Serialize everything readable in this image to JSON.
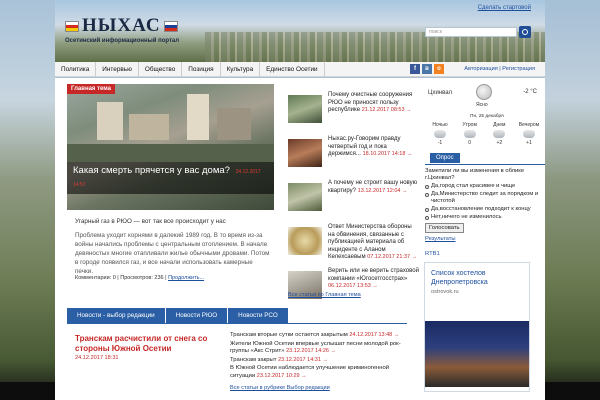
{
  "site": {
    "logo_text": "НЫХАС",
    "tagline": "Осетинский информационный портал",
    "make_start_page": "Сделать стартовой"
  },
  "search": {
    "placeholder": "поиск"
  },
  "nav": {
    "items": [
      "Политика",
      "Интервью",
      "Общество",
      "Позиция",
      "Культура",
      "Единство Осетии"
    ],
    "auth": "Авторизация | Регистрация",
    "social": [
      {
        "icon": "facebook-icon",
        "letter": "f",
        "color": "#3b5998"
      },
      {
        "icon": "vkontakte-icon",
        "letter": "в",
        "color": "#4a76a8"
      },
      {
        "icon": "odnoklassniki-icon",
        "letter": "о",
        "color": "#f58220"
      }
    ]
  },
  "feature": {
    "label": "Главная тема",
    "title": "Какая смерть прячется у вас дома?",
    "title_date": "24.12.2017 14:57",
    "lead": "Угарный газ в РЮО — вот так все происходит у нас",
    "body": "Проблема уходит корнями в далекий 1989 год. В то время из-за войны начались проблемы с центральным отоплением. В начале девяностых многие отапливали жилье обычными дровами. Потом в городе появился газ, и все начали использовать камерные печки.",
    "stats": "Комментарии: 0 | Просмотров: 236 |",
    "more": "Продолжить..."
  },
  "news": [
    {
      "text": "Почему очистные сооружения РЮО не приносят пользу республике",
      "date": "21.12.2017 08:53 →"
    },
    {
      "text": "Ныхас.ру-Говорим правду четвертый год и пока держимся...",
      "date": "18.10.2017 14:18 →"
    },
    {
      "text": "А почему не строит вашу новую квартиру?",
      "date": "13.12.2017 12:04 →"
    },
    {
      "text": "Ответ Министерства обороны на обвинения, связанные с публикацией материала об инциденте с Аланом Келехсаевым",
      "date": "07.12.2017 21:37 →"
    },
    {
      "text": "Верить или не верить страховой компании «Югосетгосстрах»",
      "date": "06.12.2017 13:53 →"
    }
  ],
  "all_news_link": "Все статьи по Главная тема",
  "tabs": {
    "items": [
      "Новости - выбор редакции",
      "Новости РЮО",
      "Новости РСО"
    ],
    "main_title": "Транскам расчистили от снега со стороны Южной Осетии",
    "main_date": "24.12.2017 18:31",
    "list": [
      {
        "text": "Транскам вторые сутки остается закрытым",
        "date": "24.12.2017 13:48 →"
      },
      {
        "text": "Жители Южной Осетии впервые услышат песни молодой рок-группы «Акс Стрит»",
        "date": "23.12.2017 14:26 →"
      },
      {
        "text": "Транскам закрыт",
        "date": "23.12.2017 14:31 →"
      },
      {
        "text": "В Южной Осетии наблюдается улучшение криминогенной ситуации",
        "date": "23.12.2017 10:29 →"
      }
    ],
    "all_link": "Все статьи в рубрике Выбор редакции"
  },
  "weather": {
    "city": "Цхинвал",
    "condition": "Ясно",
    "temp": "-2 °C",
    "date": "Пн, 25 декабря",
    "periods": [
      {
        "name": "Ночью",
        "temp": "-1"
      },
      {
        "name": "Утром",
        "temp": "0"
      },
      {
        "name": "Днем",
        "temp": "+2"
      },
      {
        "name": "Вечером",
        "temp": "+1"
      }
    ]
  },
  "poll": {
    "header": "Опрос",
    "question": "Заметили ли вы изменения в облике г.Цхинвал?",
    "options": [
      "Да,город стал красивее и чище",
      "Да,Министерство следит за порядком и чистотой",
      "Да,восстановление подходит к концу",
      "Нет,ничего не изменилось"
    ],
    "vote_button": "Голосовать",
    "results_link": "Результаты"
  },
  "ad": {
    "label": "RTB1",
    "title": "Список хостелов Днепропетровска",
    "source": "ostrovok.ru"
  }
}
